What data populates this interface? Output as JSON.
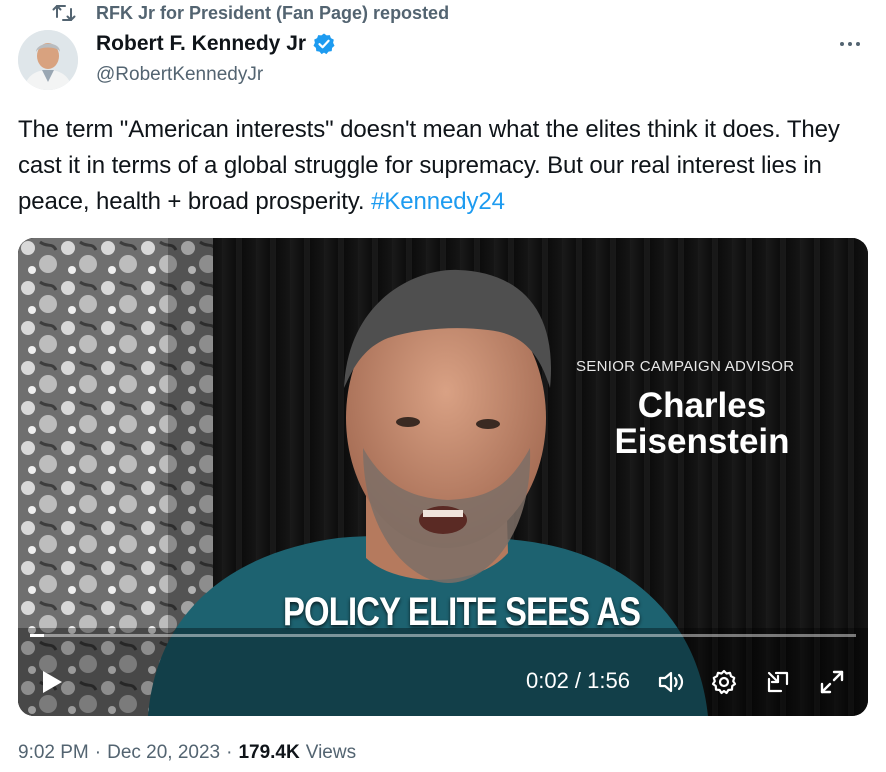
{
  "repost": {
    "icon": "repost-icon",
    "text": "RFK Jr for President (Fan Page) reposted"
  },
  "author": {
    "display_name": "Robert F. Kennedy Jr",
    "verified": true,
    "verified_color": "#1d9bf0",
    "handle": "@RobertKennedyJr"
  },
  "more_icon": "more-horizontal-icon",
  "tweet": {
    "text": "The term \"American interests\" doesn't mean what the elites think it does. They cast it in terms of a global struggle for supremacy. But our real interest lies in peace, health + broad prosperity. ",
    "hashtag": "#Kennedy24",
    "hashtag_color": "#1d9bf0"
  },
  "video": {
    "overlay_role": "SENIOR CAMPAIGN ADVISOR",
    "overlay_name": "Charles Eisenstein",
    "caption": "POLICY ELITE SEES AS",
    "progress_fraction": 0.017,
    "time_readout": "0:02 / 1:56",
    "controls": [
      "play-icon",
      "volume-icon",
      "settings-icon",
      "pop-out-icon",
      "fullscreen-icon"
    ]
  },
  "meta": {
    "time": "9:02 PM",
    "date": "Dec 20, 2023",
    "views_count": "179.4K",
    "views_label": "Views",
    "separator": "·"
  },
  "colors": {
    "text_primary": "#0f1419",
    "text_secondary": "#536471",
    "accent": "#1d9bf0"
  }
}
